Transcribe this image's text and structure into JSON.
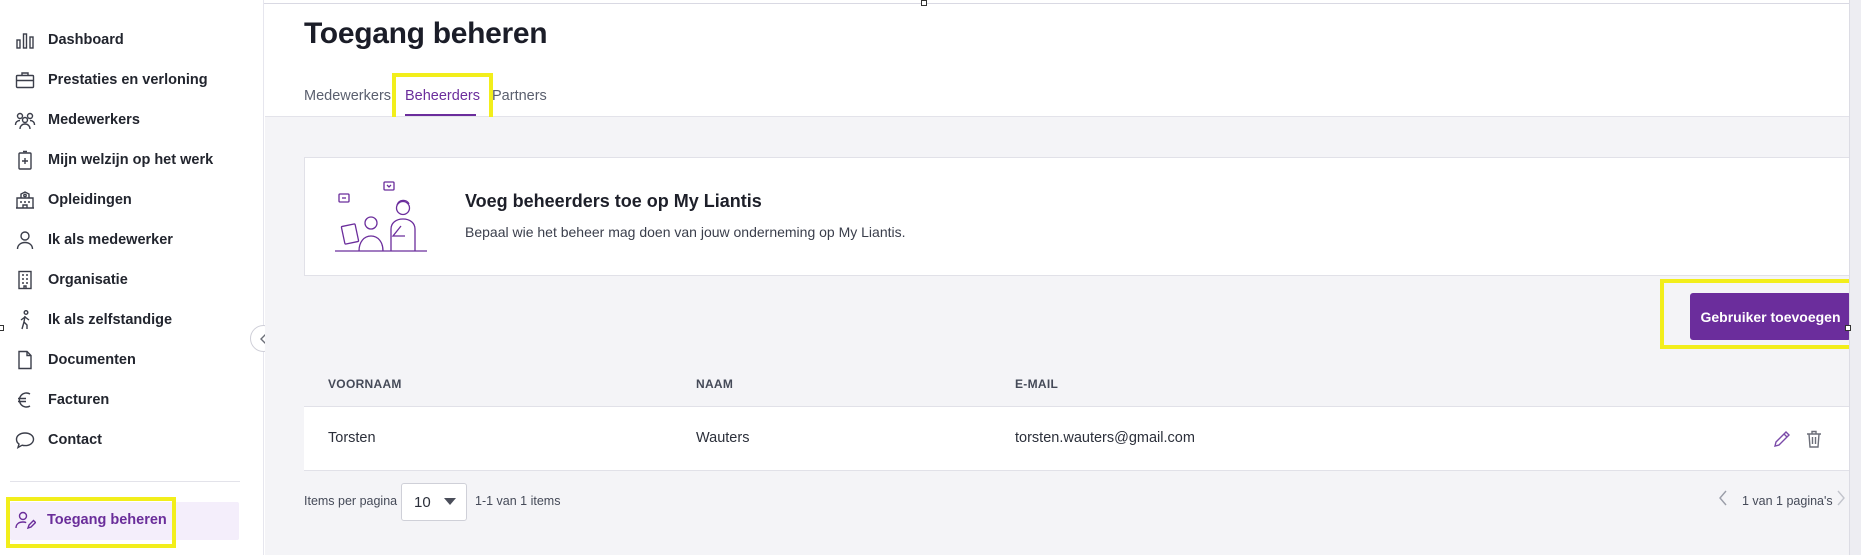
{
  "sidebar": {
    "items": [
      {
        "label": "Dashboard",
        "icon": "bar-chart-icon"
      },
      {
        "label": "Prestaties en verloning",
        "icon": "briefcase-icon"
      },
      {
        "label": "Medewerkers",
        "icon": "people-icon"
      },
      {
        "label": "Mijn welzijn op het werk",
        "icon": "medkit-icon"
      },
      {
        "label": "Opleidingen",
        "icon": "school-building-icon"
      },
      {
        "label": "Ik als medewerker",
        "icon": "person-icon"
      },
      {
        "label": "Organisatie",
        "icon": "office-building-icon"
      },
      {
        "label": "Ik als zelfstandige",
        "icon": "walking-person-icon"
      },
      {
        "label": "Documenten",
        "icon": "document-icon"
      },
      {
        "label": "Facturen",
        "icon": "euro-icon"
      },
      {
        "label": "Contact",
        "icon": "chat-bubble-icon"
      }
    ],
    "active": {
      "label": "Toegang beheren",
      "icon": "user-edit-icon"
    }
  },
  "page": {
    "title": "Toegang beheren",
    "tabs": [
      {
        "label": "Medewerkers",
        "active": false
      },
      {
        "label": "Beheerders",
        "active": true
      },
      {
        "label": "Partners",
        "active": false
      }
    ]
  },
  "card": {
    "title": "Voeg beheerders toe op My Liantis",
    "subtitle": "Bepaal wie het beheer mag doen van jouw onderneming op My Liantis."
  },
  "actions": {
    "add_user": "Gebruiker toevoegen"
  },
  "table": {
    "columns": [
      "VOORNAAM",
      "NAAM",
      "E-MAIL"
    ],
    "rows": [
      {
        "voornaam": "Torsten",
        "naam": "Wauters",
        "email": "torsten.wauters@gmail.com"
      }
    ]
  },
  "pagination": {
    "items_per_page_label": "Items per pagina",
    "page_size": "10",
    "range": "1-1 van 1 items",
    "pages": "1 van 1 pagina's"
  },
  "colors": {
    "accent": "#6b2d9c",
    "highlight": "#f2ee1b"
  }
}
